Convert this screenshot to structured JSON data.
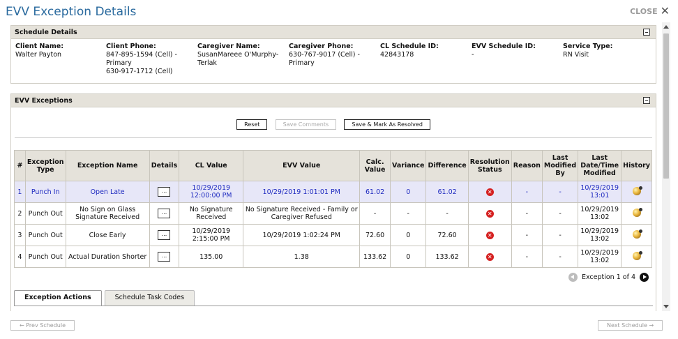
{
  "window": {
    "title": "EVV Exception Details",
    "close_label": "CLOSE"
  },
  "schedule": {
    "heading": "Schedule Details",
    "fields": [
      {
        "label": "Client Name:",
        "value": "Walter Payton"
      },
      {
        "label": "Client Phone:",
        "value": "847-895-1594 (Cell) - Primary",
        "value2": "630-917-1712 (Cell)"
      },
      {
        "label": "Caregiver Name:",
        "value": "SusanMareee O'Murphy-Terlak"
      },
      {
        "label": "Caregiver Phone:",
        "value": "630-767-9017 (Cell) - Primary"
      },
      {
        "label": "CL Schedule ID:",
        "value": "42843178"
      },
      {
        "label": "EVV Schedule ID:",
        "value": "-"
      },
      {
        "label": "Service Type:",
        "value": "RN Visit"
      }
    ]
  },
  "exceptions": {
    "heading": "EVV Exceptions",
    "buttons": {
      "reset": "Reset",
      "save_comments": "Save Comments",
      "save_resolve": "Save & Mark As Resolved"
    },
    "columns": [
      "#",
      "Exception Type",
      "Exception Name",
      "Details",
      "CL Value",
      "EVV Value",
      "Calc. Value",
      "Variance",
      "Difference",
      "Resolution Status",
      "Reason",
      "Last Modified By",
      "Last Date/Time Modified",
      "History"
    ],
    "details_label": "...",
    "rows": [
      {
        "num": "1",
        "type": "Punch In",
        "name": "Open Late",
        "cl": "10/29/2019 12:00:00 PM",
        "evv": "10/29/2019 1:01:01 PM",
        "calc": "61.02",
        "variance": "0",
        "difference": "61.02",
        "reason": "-",
        "modified_by": "-",
        "modified": "10/29/2019 13:01"
      },
      {
        "num": "2",
        "type": "Punch Out",
        "name": "No Sign on Glass Signature Received",
        "cl": "No Signature Received",
        "evv": "No Signature Received - Family or Caregiver Refused",
        "calc": "-",
        "variance": "-",
        "difference": "-",
        "reason": "-",
        "modified_by": "-",
        "modified": "10/29/2019 13:02"
      },
      {
        "num": "3",
        "type": "Punch Out",
        "name": "Close Early",
        "cl": "10/29/2019 2:15:00 PM",
        "evv": "10/29/2019 1:02:24 PM",
        "calc": "72.60",
        "variance": "0",
        "difference": "72.60",
        "reason": "-",
        "modified_by": "-",
        "modified": "10/29/2019 13:02"
      },
      {
        "num": "4",
        "type": "Punch Out",
        "name": "Actual Duration Shorter",
        "cl": "135.00",
        "evv": "1.38",
        "calc": "133.62",
        "variance": "0",
        "difference": "133.62",
        "reason": "-",
        "modified_by": "-",
        "modified": "10/29/2019 13:02"
      }
    ],
    "pager": "Exception 1 of 4",
    "tabs": [
      "Exception Actions",
      "Schedule Task Codes"
    ]
  },
  "footer": {
    "prev": "←  Prev Schedule",
    "next": "Next Schedule  →"
  },
  "colors": {
    "title": "#2a6a9e",
    "selected_row_bg": "#e7e7f8",
    "selected_row_text": "#1f2bc0",
    "panel_header": "#e5e2da",
    "status_unresolved": "#d52020"
  },
  "icons": {
    "resolution_status": "x-circle-icon",
    "history": "history-icon"
  }
}
